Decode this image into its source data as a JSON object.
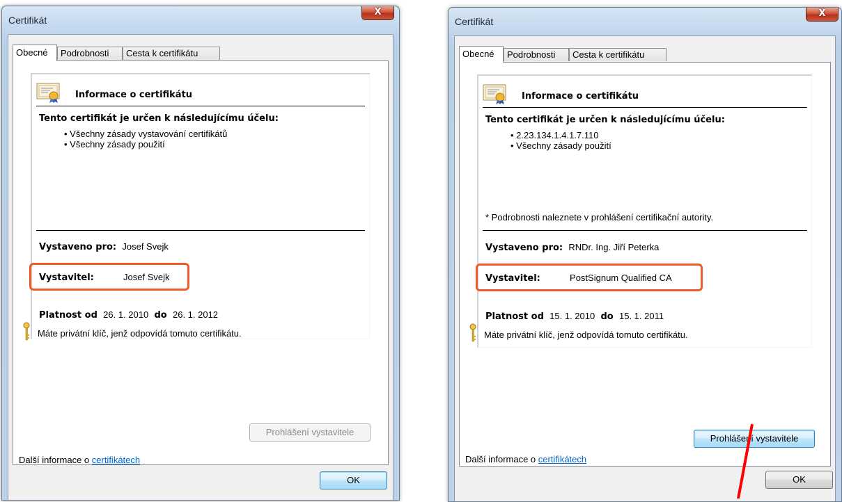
{
  "dialogs": [
    {
      "title": "Certifikát",
      "close_label": "X",
      "tabs": [
        "Obecné",
        "Podrobnosti",
        "Cesta k certifikátu"
      ],
      "info_title": "Informace o certifikátu",
      "purpose_heading": "Tento certifikát je určen k následujícímu účelu:",
      "purposes": [
        "Všechny zásady vystavování certifikátů",
        "Všechny zásady použití"
      ],
      "note": "",
      "issued_to_label": "Vystaveno pro:",
      "issued_to": "Josef Svejk",
      "issuer_label": "Vystavitel:",
      "issuer": "Josef Svejk",
      "valid_label": "Platnost od",
      "valid_from": "26. 1. 2010",
      "valid_to_label": "do",
      "valid_to": "26. 1. 2012",
      "private_key_text": "Máte privátní klíč, jenž odpovídá tomuto certifikátu.",
      "issuer_statement_button": "Prohlášení vystavitele",
      "issuer_statement_enabled": false,
      "more_info_prefix": "Další informace o ",
      "more_info_link": "certifikátech",
      "ok_button": "OK"
    },
    {
      "title": "Certifikát",
      "close_label": "X",
      "tabs": [
        "Obecné",
        "Podrobnosti",
        "Cesta k certifikátu"
      ],
      "info_title": "Informace o certifikátu",
      "purpose_heading": "Tento certifikát je určen k následujícímu účelu:",
      "purposes": [
        "2.23.134.1.4.1.7.110",
        "Všechny zásady použití"
      ],
      "note": "* Podrobnosti naleznete v prohlášení certifikační autority.",
      "issued_to_label": "Vystaveno pro:",
      "issued_to": "RNDr. Ing. Jiří Peterka",
      "issuer_label": "Vystavitel:",
      "issuer": "PostSignum Qualified CA",
      "valid_label": "Platnost od",
      "valid_from": "15. 1. 2010",
      "valid_to_label": "do",
      "valid_to": "15. 1. 2011",
      "private_key_text": "Máte privátní klíč, jenž odpovídá tomuto certifikátu.",
      "issuer_statement_button": "Prohlášení vystavitele",
      "issuer_statement_enabled": true,
      "more_info_prefix": "Další informace o ",
      "more_info_link": "certifikátech",
      "ok_button": "OK"
    }
  ],
  "colors": {
    "highlight": "#ef5a2a",
    "arrow": "#ff0000",
    "link": "#0066cc"
  }
}
